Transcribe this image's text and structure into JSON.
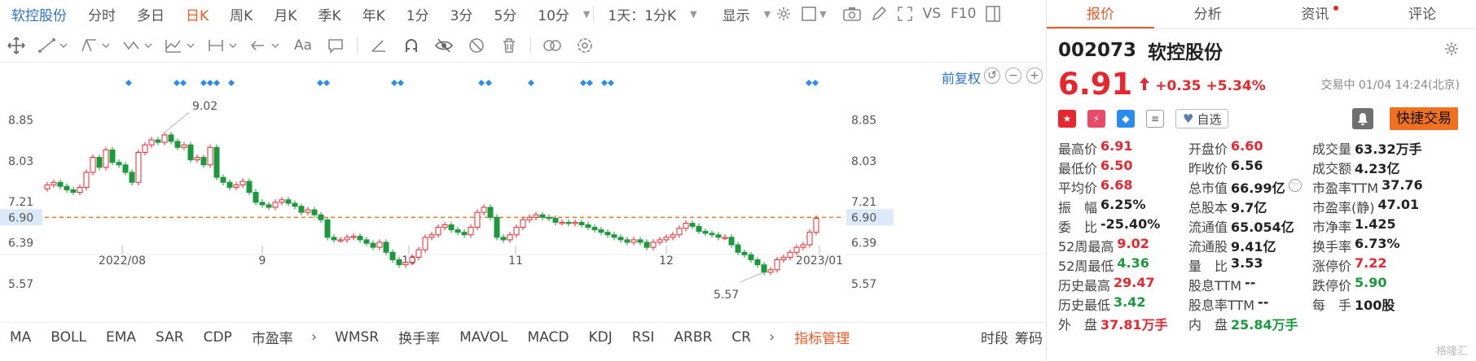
{
  "period_bar": {
    "stock_label": "软控股份",
    "tabs": [
      "分时",
      "多日",
      "日K",
      "周K",
      "月K",
      "季K",
      "年K",
      "1分",
      "3分",
      "5分",
      "10分"
    ],
    "active_tab": "日K",
    "interval_select": "1天：1分K",
    "display_label": "显示",
    "vs_label": "VS",
    "f10_label": "F10"
  },
  "chart": {
    "restore_label": "前复权",
    "high_label": "9.02",
    "low_label": "5.57",
    "current_price_tag": "6.90",
    "y_ticks": [
      "8.85",
      "8.03",
      "7.21",
      "6.90",
      "6.39",
      "5.57"
    ],
    "x_labels": [
      "2022/08",
      "9",
      "10",
      "11",
      "12",
      "2023/01"
    ],
    "colors": {
      "up": "#e8262d",
      "down": "#1a9a3c",
      "ref_line": "#f0711f",
      "marker": "#2b8cf0"
    }
  },
  "indicator_bar": {
    "items": [
      "MA",
      "BOLL",
      "EMA",
      "SAR",
      "CDP",
      "市盈率"
    ],
    "items2": [
      "WMSR",
      "换手率",
      "MAVOL",
      "MACD",
      "KDJ",
      "RSI",
      "ARBR",
      "CR"
    ],
    "manage_label": "指标管理",
    "right_items": [
      "时段",
      "筹码"
    ]
  },
  "quote": {
    "tabs": [
      "报价",
      "分析",
      "资讯",
      "评论"
    ],
    "active_tab": "报价",
    "code": "002073",
    "name": "软控股份",
    "price": "6.91",
    "change": "+0.35",
    "change_pct": "+5.34%",
    "status": "交易中 01/04 14:24(北京)",
    "watch_label": "自选",
    "quick_trade_label": "快捷交易",
    "stats": [
      [
        {
          "l": "最高价",
          "v": "6.91",
          "c": "red"
        },
        {
          "l": "开盘价",
          "v": "6.60",
          "c": "red"
        },
        {
          "l": "成交量",
          "v": "63.32万手",
          "c": "black"
        }
      ],
      [
        {
          "l": "最低价",
          "v": "6.50",
          "c": "red"
        },
        {
          "l": "昨收价",
          "v": "6.56",
          "c": "black"
        },
        {
          "l": "成交额",
          "v": "4.23亿",
          "c": "black"
        }
      ],
      [
        {
          "l": "平均价",
          "v": "6.68",
          "c": "red"
        },
        {
          "l": "总市值",
          "v": "66.99亿",
          "c": "black",
          "info": true
        },
        {
          "l": "市盈率TTM",
          "v": "37.76",
          "c": "black"
        }
      ],
      [
        {
          "l": "振　幅",
          "v": "6.25%",
          "c": "black"
        },
        {
          "l": "总股本",
          "v": "9.7亿",
          "c": "black"
        },
        {
          "l": "市盈率(静)",
          "v": "47.01",
          "c": "black"
        }
      ],
      [
        {
          "l": "委　比",
          "v": "-25.40%",
          "c": "black"
        },
        {
          "l": "流通值",
          "v": "65.054亿",
          "c": "black"
        },
        {
          "l": "市净率",
          "v": "1.425",
          "c": "black"
        }
      ],
      [
        {
          "l": "52周最高",
          "v": "9.02",
          "c": "red"
        },
        {
          "l": "流通股",
          "v": "9.41亿",
          "c": "black"
        },
        {
          "l": "换手率",
          "v": "6.73%",
          "c": "black"
        }
      ],
      [
        {
          "l": "52周最低",
          "v": "4.36",
          "c": "green"
        },
        {
          "l": "量　比",
          "v": "3.53",
          "c": "black"
        },
        {
          "l": "涨停价",
          "v": "7.22",
          "c": "red"
        }
      ],
      [
        {
          "l": "历史最高",
          "v": "29.47",
          "c": "red"
        },
        {
          "l": "股息TTM",
          "v": "--",
          "c": "black"
        },
        {
          "l": "跌停价",
          "v": "5.90",
          "c": "green"
        }
      ],
      [
        {
          "l": "历史最低",
          "v": "3.42",
          "c": "green"
        },
        {
          "l": "股息率TTM",
          "v": "--",
          "c": "black"
        },
        {
          "l": "每　手",
          "v": "100股",
          "c": "black"
        }
      ],
      [
        {
          "l": "外　盘",
          "v": "37.81万手",
          "c": "red"
        },
        {
          "l": "内　盘",
          "v": "25.84万手",
          "c": "green"
        },
        {
          "l": "",
          "v": "",
          "c": "black"
        }
      ]
    ],
    "watermark": "格隆汇"
  }
}
